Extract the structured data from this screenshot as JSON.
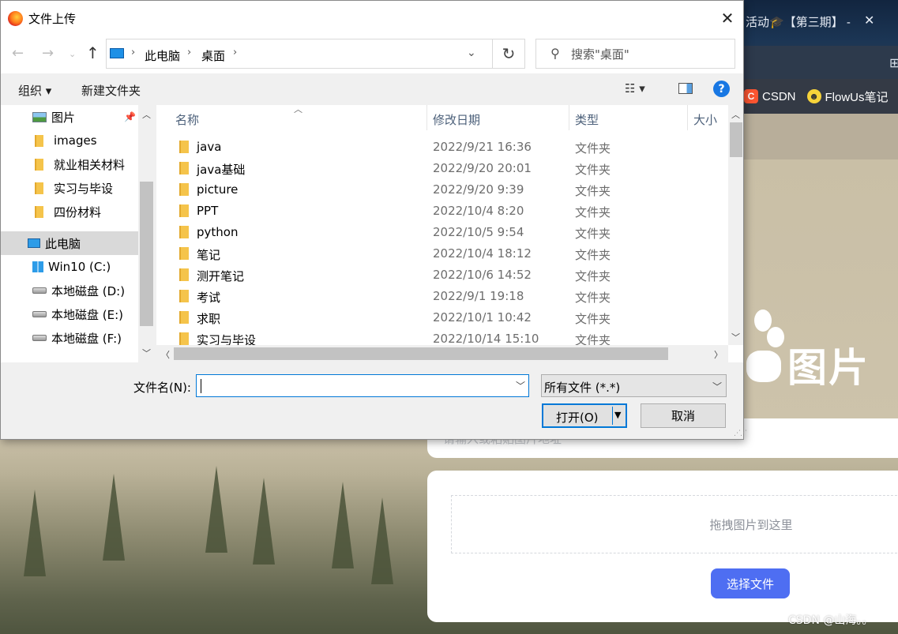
{
  "background": {
    "tab_title": "活动🎓【第三期】 -",
    "tab_close": "✕",
    "bookmarks": [
      {
        "label": "CSDN",
        "icon": "csdn-logo-icon",
        "glyph": "C"
      },
      {
        "label": "FlowUs笔记",
        "icon": "smiley-icon",
        "glyph": "☻"
      }
    ],
    "logo_text": "图片",
    "url_placeholder": "请输入或粘贴图片地址",
    "drop_zone_text": "拖拽图片到这里",
    "choose_file_button": "选择文件",
    "watermark": "CSDN @山海。。"
  },
  "dialog": {
    "title": "文件上传",
    "close_glyph": "✕",
    "nav": {
      "back_glyph": "←",
      "forward_glyph": "→",
      "recent_glyph": "⌄",
      "up_glyph": "↑",
      "breadcrumb": [
        "此电脑",
        "桌面"
      ],
      "refresh_glyph": "↻",
      "search_placeholder": "搜索\"桌面\""
    },
    "toolbar": {
      "organize_label": "组织 ▾",
      "new_folder_label": "新建文件夹",
      "view_glyph": "☷  ▾",
      "help_glyph": "?"
    },
    "navpane": {
      "items": [
        {
          "label": "图片",
          "icon": "pictures-icon",
          "pinned": true
        },
        {
          "label": "images",
          "icon": "folder-icon"
        },
        {
          "label": "就业相关材料",
          "icon": "folder-icon"
        },
        {
          "label": "实习与毕设",
          "icon": "folder-icon"
        },
        {
          "label": "四份材料",
          "icon": "folder-icon"
        },
        {
          "label": "此电脑",
          "icon": "this-pc-icon",
          "selected": true
        },
        {
          "label": "Win10 (C:)",
          "icon": "windows-drive-icon"
        },
        {
          "label": "本地磁盘 (D:)",
          "icon": "drive-icon"
        },
        {
          "label": "本地磁盘 (E:)",
          "icon": "drive-icon"
        },
        {
          "label": "本地磁盘 (F:)",
          "icon": "drive-icon"
        }
      ],
      "scroll_fraction": 0.3
    },
    "columns": [
      "名称",
      "修改日期",
      "类型",
      "大小"
    ],
    "files": [
      {
        "name": "java",
        "modified": "2022/9/21 16:36",
        "type": "文件夹"
      },
      {
        "name": "java基础",
        "modified": "2022/9/20 20:01",
        "type": "文件夹"
      },
      {
        "name": "picture",
        "modified": "2022/9/20 9:39",
        "type": "文件夹"
      },
      {
        "name": "PPT",
        "modified": "2022/10/4 8:20",
        "type": "文件夹"
      },
      {
        "name": "python",
        "modified": "2022/10/5 9:54",
        "type": "文件夹"
      },
      {
        "name": "笔记",
        "modified": "2022/10/4 18:12",
        "type": "文件夹"
      },
      {
        "name": "测开笔记",
        "modified": "2022/10/6 14:52",
        "type": "文件夹"
      },
      {
        "name": "考试",
        "modified": "2022/9/1 19:18",
        "type": "文件夹"
      },
      {
        "name": "求职",
        "modified": "2022/10/1 10:42",
        "type": "文件夹"
      },
      {
        "name": "实习与毕设",
        "modified": "2022/10/14 15:10",
        "type": "文件夹"
      }
    ],
    "filename_label": "文件名(N):",
    "filename_value": "",
    "filetype_value": "所有文件 (*.*)",
    "open_button": "打开(O)",
    "cancel_button": "取消"
  }
}
